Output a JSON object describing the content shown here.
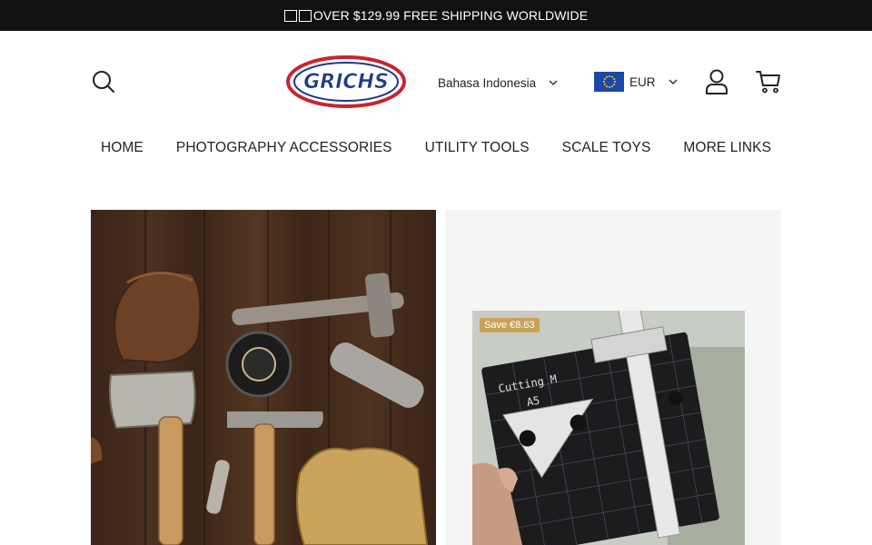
{
  "announcement": {
    "text": "OVER $129.99 FREE SHIPPING WORLDWIDE"
  },
  "header": {
    "logo_text": "GRICHS",
    "language": "Bahasa Indonesia",
    "currency": "EUR"
  },
  "nav": {
    "items": [
      {
        "label": "HOME"
      },
      {
        "label": "PHOTOGRAPHY ACCESSORIES"
      },
      {
        "label": "UTILITY TOOLS"
      },
      {
        "label": "SCALE TOYS"
      },
      {
        "label": "MORE LINKS"
      }
    ]
  },
  "hero": {
    "left_image": "workshop-tools-photo",
    "product": {
      "badge": "Save €8.63",
      "mat_label": "Cutting M",
      "mat_size": "A5"
    }
  },
  "colors": {
    "announcement_bg": "#111111",
    "badge_bg": "#c9a25a",
    "logo_red": "#c8242c",
    "logo_blue": "#1e3a8a",
    "flag_blue": "#1d47a8"
  }
}
